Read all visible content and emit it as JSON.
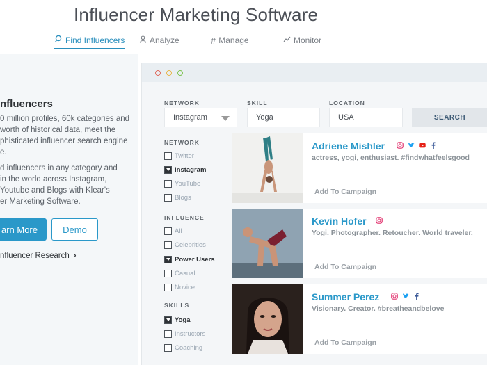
{
  "header": {
    "title": "Influencer Marketing Software"
  },
  "tabs": [
    {
      "label": "Find Influencers",
      "icon": "search-person-icon"
    },
    {
      "label": "Analyze",
      "icon": "person-icon"
    },
    {
      "label": "Manage",
      "icon": "hash-icon"
    },
    {
      "label": "Monitor",
      "icon": "trend-icon"
    }
  ],
  "left_panel": {
    "heading": "nfluencers",
    "text1": "0 million profiles, 60k categories and\nworth of historical data, meet the\nphisticated influencer search engine\ne.",
    "text2": "d influencers in any category and\nin the world across Instagram,\nYoutube and Blogs with Klear's\ner Marketing Software.",
    "learn_more": "arn More",
    "demo": "Demo",
    "research_link": "nfluencer Research"
  },
  "search": {
    "network_label": "NETWORK",
    "network_value": "Instagram",
    "skill_label": "SKILL",
    "skill_value": "Yoga",
    "location_label": "LOCATION",
    "location_value": "USA",
    "search_button": "SEARCH"
  },
  "filters": {
    "network": {
      "label": "NETWORK",
      "options": [
        {
          "label": "Twitter",
          "checked": false
        },
        {
          "label": "Instagram",
          "checked": true
        },
        {
          "label": "YouTube",
          "checked": false
        },
        {
          "label": "Blogs",
          "checked": false
        }
      ]
    },
    "influence": {
      "label": "INFLUENCE",
      "options": [
        {
          "label": "All",
          "checked": false
        },
        {
          "label": "Celebrities",
          "checked": false
        },
        {
          "label": "Power Users",
          "checked": true
        },
        {
          "label": "Casual",
          "checked": false
        },
        {
          "label": "Novice",
          "checked": false
        }
      ]
    },
    "skills": {
      "label": "SKILLS",
      "options": [
        {
          "label": "Yoga",
          "checked": true
        },
        {
          "label": "Instructors",
          "checked": false
        },
        {
          "label": "Coaching",
          "checked": false
        }
      ]
    }
  },
  "results": [
    {
      "name": "Adriene Mishler",
      "bio": "actress, yogi, enthusiast. #findwhatfeelsgood",
      "add_label": "Add To Campaign",
      "socials": [
        "instagram-icon",
        "twitter-icon",
        "youtube-icon",
        "facebook-icon"
      ]
    },
    {
      "name": "Kevin Hofer",
      "bio": "Yogi. Photographer. Retoucher. World traveler.",
      "add_label": "Add To Campaign",
      "socials": [
        "instagram-icon"
      ]
    },
    {
      "name": "Summer Perez",
      "bio": "Visionary. Creator. #breatheandbelove",
      "add_label": "Add To Campaign",
      "socials": [
        "instagram-icon",
        "twitter-icon",
        "facebook-icon"
      ]
    }
  ],
  "colors": {
    "accent": "#2a98c9",
    "instagram": "#e1306c",
    "twitter": "#1da1f2",
    "youtube": "#e62117",
    "facebook": "#3b5998"
  }
}
